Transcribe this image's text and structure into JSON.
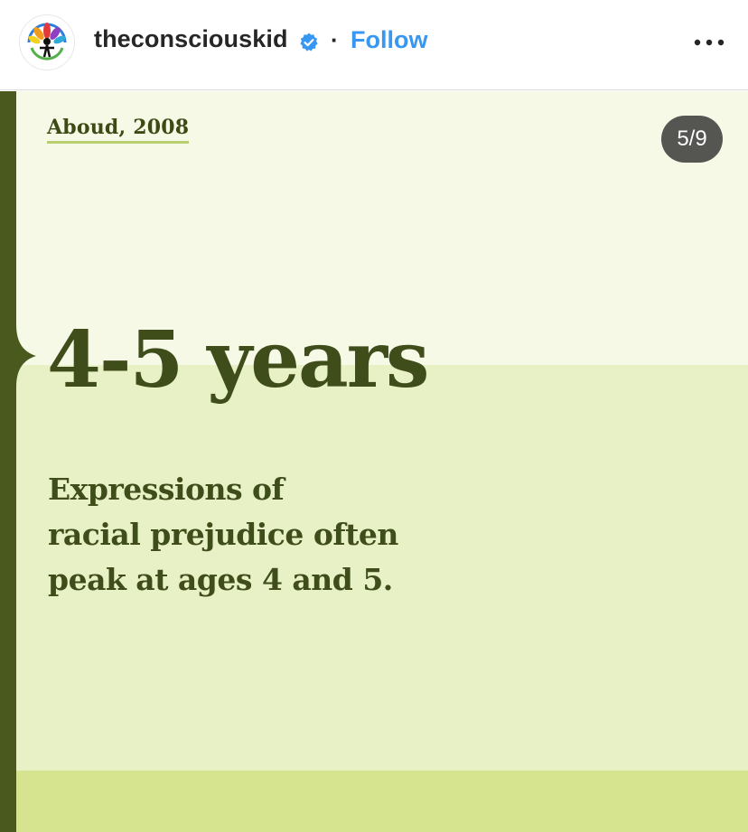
{
  "header": {
    "username": "theconsciouskid",
    "separator": "·",
    "follow_label": "Follow",
    "more_icon": "more-horizontal-icon",
    "verified_icon": "verified-badge-icon",
    "colors": {
      "follow": "#3897f0",
      "verified": "#3897f0"
    }
  },
  "post": {
    "citation": "Aboud, 2008",
    "counter": "5/9",
    "headline": "4-5 years",
    "body_lines": [
      "Expressions of",
      "racial prejudice often",
      "peak at ages 4 and 5."
    ],
    "colors": {
      "dark_green": "#3f4d1a",
      "pale": "#f5f9e6",
      "light": "#e8f0c5",
      "lime": "#d6e48f"
    }
  }
}
